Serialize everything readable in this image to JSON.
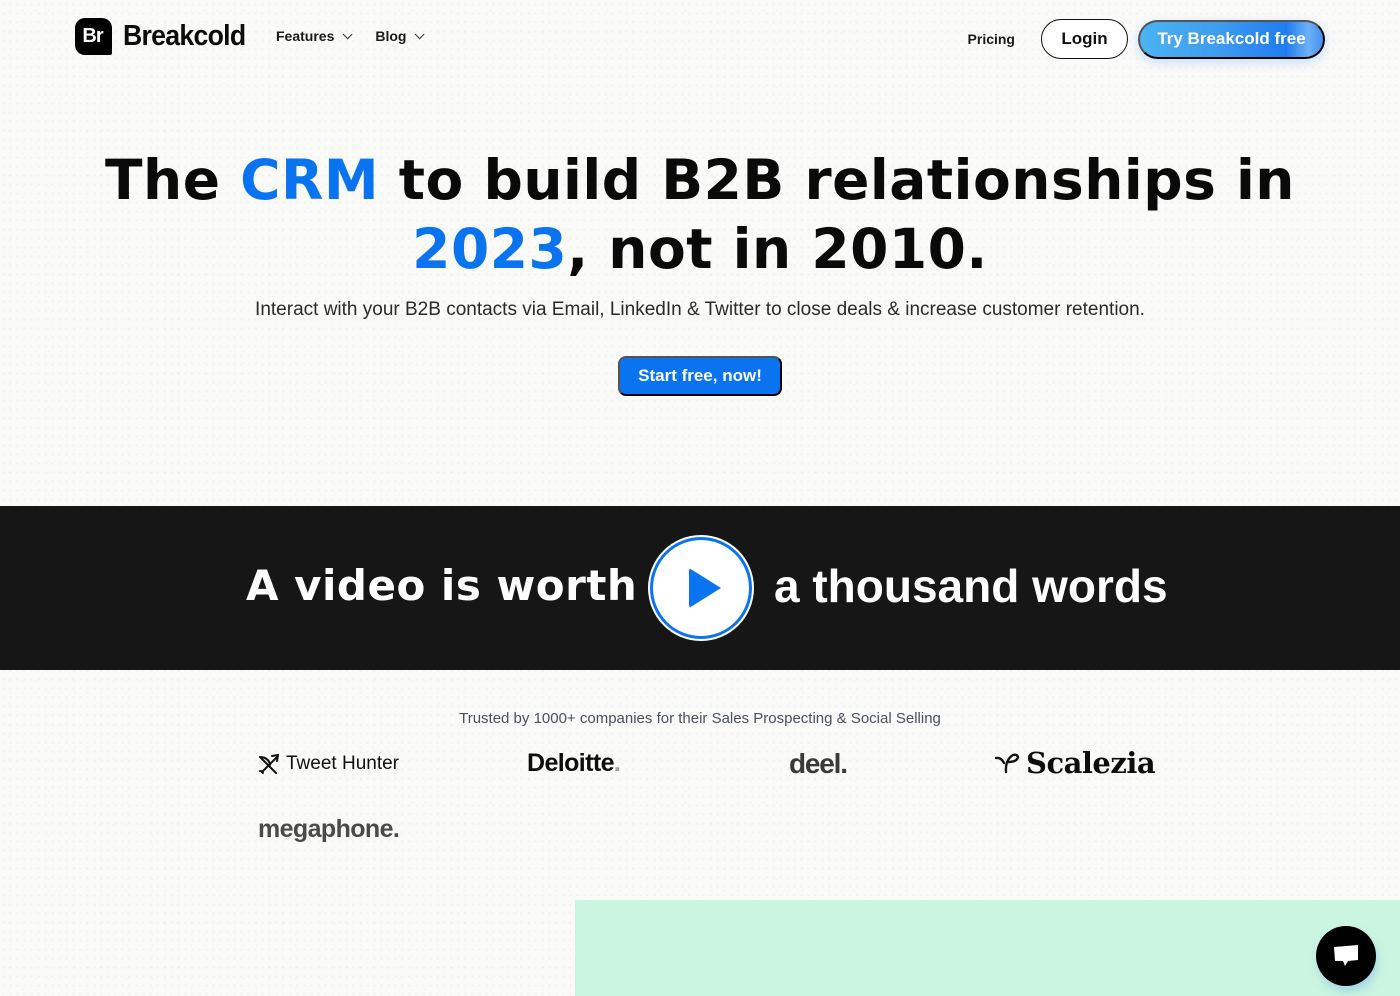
{
  "nav": {
    "logo_mark": "Br",
    "logo_text": "Breakcold",
    "menu": [
      {
        "label": "Features",
        "has_dropdown": true
      },
      {
        "label": "Blog",
        "has_dropdown": true
      }
    ],
    "pricing_label": "Pricing",
    "login_label": "Login",
    "try_label": "Try Breakcold free"
  },
  "hero": {
    "title_part1": "The ",
    "title_accent1": "CRM",
    "title_part2": " to build B2B relationships in",
    "title_accent2": "2023",
    "title_part3": ", not in 2010.",
    "subtitle": "Interact with your B2B contacts via Email, LinkedIn & Twitter to close deals & increase customer retention.",
    "cta_label": "Start free, now!"
  },
  "video": {
    "left_text": "A video is worth",
    "right_text": "a thousand words",
    "play_icon": "play-icon"
  },
  "trust": {
    "heading": "Trusted by 1000+ companies for their Sales Prospecting & Social Selling",
    "logos": [
      {
        "name": "Tweet Hunter",
        "icon": "bow-arrow-icon"
      },
      {
        "name": "Deloitte",
        "suffix": "."
      },
      {
        "name": "deel."
      },
      {
        "name": "Scalezia",
        "icon": "sprout-icon"
      },
      {
        "name": "megaphone."
      }
    ]
  },
  "chat": {
    "icon": "chat-bubble-icon"
  },
  "colors": {
    "accent": "#0a74f0",
    "dark_band": "#161616",
    "mint": "#c9f5e1"
  }
}
